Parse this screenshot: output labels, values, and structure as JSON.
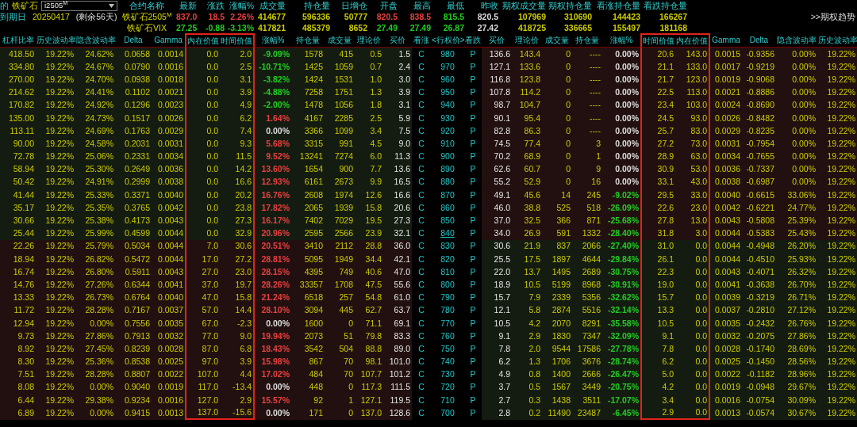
{
  "toolbar": {
    "cut_label": "的",
    "product": "铁矿石",
    "contract_select": "i2505$^{M}$"
  },
  "expiry": {
    "label": "到期日",
    "date": "20250417",
    "remaining": "(剩余56天)"
  },
  "quote_columns": [
    "合约名称",
    "最新",
    "涨跌",
    "涨幅%",
    "成交量",
    "持仓量",
    "日增仓",
    "开盘",
    "最高",
    "最低",
    "昨收",
    "期权成交量",
    "期权持仓量",
    "看涨持仓量",
    "看跌持仓量"
  ],
  "quotes": [
    {
      "name": "铁矿石2505$^{M}$",
      "values": [
        {
          "text": "837.0",
          "color": "#e84040"
        },
        {
          "text": "18.5",
          "color": "#e84040"
        },
        {
          "text": "2.26%",
          "color": "#e84040"
        },
        {
          "text": "414677",
          "color": "#cccc00"
        },
        {
          "text": "596336",
          "color": "#cccc00"
        },
        {
          "text": "50777",
          "color": "#cccc00"
        },
        {
          "text": "820.5",
          "color": "#e84040"
        },
        {
          "text": "838.5",
          "color": "#e84040"
        },
        {
          "text": "815.5",
          "color": "#22cc22"
        },
        {
          "text": "820.5",
          "color": "#dddddd"
        },
        {
          "text": "107969",
          "color": "#cccc00"
        },
        {
          "text": "310690",
          "color": "#cccc00"
        },
        {
          "text": "144423",
          "color": "#cccc00"
        },
        {
          "text": "166267",
          "color": "#cccc00"
        }
      ]
    },
    {
      "name": "铁矿石VIX",
      "values": [
        {
          "text": "27.25",
          "color": "#22cc22"
        },
        {
          "text": "-0.88",
          "color": "#22cc22"
        },
        {
          "text": "-3.13%",
          "color": "#22cc22"
        },
        {
          "text": "417821",
          "color": "#cccc00"
        },
        {
          "text": "485379",
          "color": "#cccc00"
        },
        {
          "text": "8652",
          "color": "#cccc00"
        },
        {
          "text": "27.49",
          "color": "#22cc22"
        },
        {
          "text": "27.49",
          "color": "#22cc22"
        },
        {
          "text": "26.87",
          "color": "#22cc22"
        },
        {
          "text": "27.42",
          "color": "#dddddd"
        },
        {
          "text": "418725",
          "color": "#cccc00"
        },
        {
          "text": "336665",
          "color": "#cccc00"
        },
        {
          "text": "155497",
          "color": "#cccc00"
        },
        {
          "text": "181168",
          "color": "#cccc00"
        }
      ]
    }
  ],
  "trend_link": ">>期权趋势",
  "call_columns": [
    {
      "label": "杠杆比率",
      "highlighted": false
    },
    {
      "label": "历史波动率",
      "highlighted": false
    },
    {
      "label": "隐含波动率",
      "highlighted": false
    },
    {
      "label": "Delta",
      "highlighted": false
    },
    {
      "label": "Gamma",
      "highlighted": false
    },
    {
      "label": "内在价值",
      "highlighted": true
    },
    {
      "label": "时间价值",
      "highlighted": true
    },
    {
      "label": "涨幅%",
      "highlighted": false
    },
    {
      "label": "持仓量",
      "highlighted": false
    },
    {
      "label": "成交量",
      "highlighted": false
    },
    {
      "label": "理论价",
      "highlighted": false
    },
    {
      "label": "买价",
      "highlighted": false
    },
    {
      "label": "看涨",
      "highlighted": false
    }
  ],
  "strike_header": "<行权价>",
  "put_columns": [
    {
      "label": "看跌",
      "highlighted": false
    },
    {
      "label": "买价",
      "highlighted": false
    },
    {
      "label": "理论价",
      "highlighted": false
    },
    {
      "label": "成交量",
      "highlighted": false
    },
    {
      "label": "持仓量",
      "highlighted": false
    },
    {
      "label": "涨幅%",
      "highlighted": false
    },
    {
      "label": "时间价值",
      "highlighted": true
    },
    {
      "label": "内在价值",
      "highlighted": true
    },
    {
      "label": "Gamma",
      "highlighted": false
    },
    {
      "label": "Delta",
      "highlighted": false
    },
    {
      "label": "隐含波动率",
      "highlighted": false
    },
    {
      "label": "历史波动率",
      "highlighted": false
    }
  ],
  "rows": [
    {
      "strike": "980",
      "selected": false,
      "call_itm": false,
      "put_itm": true,
      "call_change": {
        "color": "#22cc22"
      },
      "put_change": {
        "color": "#dddddd"
      },
      "call": [
        "418.50",
        "19.22%",
        "24.62%",
        "0.0658",
        "0.0014",
        "0.0",
        "2.0",
        "-9.09%",
        "1578",
        "415",
        "0.5",
        "1.5",
        "C"
      ],
      "put": [
        "P",
        "136.6",
        "143.4",
        "0",
        "----",
        "0.00%",
        "20.6",
        "143.0",
        "0.0015",
        "-0.9356",
        "0.00%",
        "19.22%"
      ]
    },
    {
      "strike": "970",
      "selected": false,
      "call_itm": false,
      "put_itm": true,
      "call_change": {
        "color": "#22cc22"
      },
      "put_change": {
        "color": "#dddddd"
      },
      "call": [
        "334.80",
        "19.22%",
        "24.67%",
        "0.0790",
        "0.0016",
        "0.0",
        "2.5",
        "-10.71%",
        "1425",
        "1059",
        "0.7",
        "2.4",
        "C"
      ],
      "put": [
        "P",
        "127.1",
        "133.6",
        "0",
        "----",
        "0.00%",
        "21.1",
        "133.0",
        "0.0017",
        "-0.9219",
        "0.00%",
        "19.22%"
      ]
    },
    {
      "strike": "960",
      "selected": false,
      "call_itm": false,
      "put_itm": true,
      "call_change": {
        "color": "#22cc22"
      },
      "put_change": {
        "color": "#dddddd"
      },
      "call": [
        "270.00",
        "19.22%",
        "24.70%",
        "0.0938",
        "0.0018",
        "0.0",
        "3.1",
        "-3.82%",
        "1424",
        "1531",
        "1.0",
        "3.0",
        "C"
      ],
      "put": [
        "P",
        "116.8",
        "123.8",
        "0",
        "----",
        "0.00%",
        "21.7",
        "123.0",
        "0.0019",
        "-0.9068",
        "0.00%",
        "19.22%"
      ]
    },
    {
      "strike": "950",
      "selected": false,
      "call_itm": false,
      "put_itm": true,
      "call_change": {
        "color": "#22cc22"
      },
      "put_change": {
        "color": "#dddddd"
      },
      "call": [
        "214.62",
        "19.22%",
        "24.41%",
        "0.1102",
        "0.0021",
        "0.0",
        "3.9",
        "-4.88%",
        "7258",
        "1751",
        "1.3",
        "3.9",
        "C"
      ],
      "put": [
        "P",
        "107.8",
        "114.2",
        "0",
        "----",
        "0.00%",
        "22.5",
        "113.0",
        "0.0021",
        "-0.8886",
        "0.00%",
        "19.22%"
      ]
    },
    {
      "strike": "940",
      "selected": false,
      "call_itm": false,
      "put_itm": true,
      "call_change": {
        "color": "#22cc22"
      },
      "put_change": {
        "color": "#dddddd"
      },
      "call": [
        "170.82",
        "19.22%",
        "24.92%",
        "0.1296",
        "0.0023",
        "0.0",
        "4.9",
        "-2.00%",
        "1478",
        "1056",
        "1.8",
        "3.1",
        "C"
      ],
      "put": [
        "P",
        "98.7",
        "104.7",
        "0",
        "----",
        "0.00%",
        "23.4",
        "103.0",
        "0.0024",
        "-0.8690",
        "0.00%",
        "19.22%"
      ]
    },
    {
      "strike": "930",
      "selected": false,
      "call_itm": false,
      "put_itm": true,
      "call_change": {
        "color": "#e84040"
      },
      "put_change": {
        "color": "#dddddd"
      },
      "call": [
        "135.00",
        "19.22%",
        "24.73%",
        "0.1517",
        "0.0026",
        "0.0",
        "6.2",
        "1.64%",
        "4167",
        "2285",
        "2.5",
        "5.9",
        "C"
      ],
      "put": [
        "P",
        "90.1",
        "95.4",
        "0",
        "----",
        "0.00%",
        "24.5",
        "93.0",
        "0.0026",
        "-0.8482",
        "0.00%",
        "19.22%"
      ]
    },
    {
      "strike": "920",
      "selected": false,
      "call_itm": false,
      "put_itm": true,
      "call_change": {
        "color": "#dddddd"
      },
      "put_change": {
        "color": "#dddddd"
      },
      "call": [
        "113.11",
        "19.22%",
        "24.69%",
        "0.1763",
        "0.0029",
        "0.0",
        "7.4",
        "0.00%",
        "3366",
        "1099",
        "3.4",
        "7.5",
        "C"
      ],
      "put": [
        "P",
        "82.8",
        "86.3",
        "0",
        "----",
        "0.00%",
        "25.7",
        "83.0",
        "0.0029",
        "-0.8235",
        "0.00%",
        "19.22%"
      ]
    },
    {
      "strike": "910",
      "selected": false,
      "call_itm": false,
      "put_itm": true,
      "call_change": {
        "color": "#e84040"
      },
      "put_change": {
        "color": "#dddddd"
      },
      "call": [
        "90.00",
        "19.22%",
        "24.58%",
        "0.2031",
        "0.0031",
        "0.0",
        "9.3",
        "5.68%",
        "3315",
        "991",
        "4.5",
        "9.0",
        "C"
      ],
      "put": [
        "P",
        "74.5",
        "77.4",
        "0",
        "3",
        "0.00%",
        "27.2",
        "73.0",
        "0.0031",
        "-0.7954",
        "0.00%",
        "19.22%"
      ]
    },
    {
      "strike": "900",
      "selected": false,
      "call_itm": false,
      "put_itm": true,
      "call_change": {
        "color": "#e84040"
      },
      "put_change": {
        "color": "#dddddd"
      },
      "call": [
        "72.78",
        "19.22%",
        "25.06%",
        "0.2331",
        "0.0034",
        "0.0",
        "11.5",
        "9.52%",
        "13241",
        "7274",
        "6.0",
        "11.3",
        "C"
      ],
      "put": [
        "P",
        "70.2",
        "68.9",
        "0",
        "1",
        "0.00%",
        "28.9",
        "63.0",
        "0.0034",
        "-0.7655",
        "0.00%",
        "19.22%"
      ]
    },
    {
      "strike": "890",
      "selected": false,
      "call_itm": false,
      "put_itm": true,
      "call_change": {
        "color": "#e84040"
      },
      "put_change": {
        "color": "#dddddd"
      },
      "call": [
        "58.94",
        "19.22%",
        "25.30%",
        "0.2649",
        "0.0036",
        "0.0",
        "14.2",
        "13.60%",
        "1654",
        "900",
        "7.7",
        "13.6",
        "C"
      ],
      "put": [
        "P",
        "62.6",
        "60.7",
        "0",
        "9",
        "0.00%",
        "30.9",
        "53.0",
        "0.0036",
        "-0.7337",
        "0.00%",
        "19.22%"
      ]
    },
    {
      "strike": "880",
      "selected": false,
      "call_itm": false,
      "put_itm": true,
      "call_change": {
        "color": "#e84040"
      },
      "put_change": {
        "color": "#dddddd"
      },
      "call": [
        "50.42",
        "19.22%",
        "24.91%",
        "0.2999",
        "0.0038",
        "0.0",
        "16.6",
        "12.93%",
        "6161",
        "2673",
        "9.9",
        "16.5",
        "C"
      ],
      "put": [
        "P",
        "55.2",
        "52.9",
        "0",
        "16",
        "0.00%",
        "33.1",
        "43.0",
        "0.0038",
        "-0.6987",
        "0.00%",
        "19.22%"
      ]
    },
    {
      "strike": "870",
      "selected": false,
      "call_itm": false,
      "put_itm": true,
      "call_change": {
        "color": "#e84040"
      },
      "put_change": {
        "color": "#22cc22"
      },
      "call": [
        "41.44",
        "19.22%",
        "25.33%",
        "0.3371",
        "0.0040",
        "0.0",
        "20.2",
        "16.76%",
        "2608",
        "1974",
        "12.6",
        "16.6",
        "C"
      ],
      "put": [
        "P",
        "49.1",
        "45.6",
        "14",
        "245",
        "-9.02%",
        "29.5",
        "33.0",
        "0.0040",
        "-0.6615",
        "33.06%",
        "19.22%"
      ]
    },
    {
      "strike": "860",
      "selected": false,
      "call_itm": false,
      "put_itm": true,
      "call_change": {
        "color": "#e84040"
      },
      "put_change": {
        "color": "#22cc22"
      },
      "call": [
        "35.17",
        "19.22%",
        "25.35%",
        "0.3765",
        "0.0042",
        "0.0",
        "23.8",
        "17.82%",
        "2065",
        "1939",
        "15.8",
        "20.6",
        "C"
      ],
      "put": [
        "P",
        "46.0",
        "38.8",
        "525",
        "518",
        "-26.09%",
        "22.6",
        "23.0",
        "0.0042",
        "-0.6221",
        "24.77%",
        "19.22%"
      ]
    },
    {
      "strike": "850",
      "selected": false,
      "call_itm": false,
      "put_itm": true,
      "call_change": {
        "color": "#e84040"
      },
      "put_change": {
        "color": "#22cc22"
      },
      "call": [
        "30.66",
        "19.22%",
        "25.38%",
        "0.4173",
        "0.0043",
        "0.0",
        "27.3",
        "16.17%",
        "7402",
        "7029",
        "19.5",
        "27.3",
        "C"
      ],
      "put": [
        "P",
        "37.0",
        "32.5",
        "366",
        "871",
        "-25.68%",
        "27.8",
        "13.0",
        "0.0043",
        "-0.5808",
        "25.39%",
        "19.22%"
      ]
    },
    {
      "strike": "840",
      "selected": true,
      "call_itm": false,
      "put_itm": true,
      "call_change": {
        "color": "#e84040"
      },
      "put_change": {
        "color": "#22cc22"
      },
      "call": [
        "25.44",
        "19.22%",
        "25.99%",
        "0.4599",
        "0.0044",
        "0.0",
        "32.9",
        "20.96%",
        "2595",
        "2566",
        "23.9",
        "32.1",
        "C"
      ],
      "put": [
        "P",
        "34.0",
        "26.9",
        "591",
        "1332",
        "-28.40%",
        "31.8",
        "3.0",
        "0.0044",
        "-0.5383",
        "25.43%",
        "19.22%"
      ]
    },
    {
      "strike": "830",
      "selected": false,
      "call_itm": true,
      "put_itm": false,
      "call_change": {
        "color": "#e84040"
      },
      "put_change": {
        "color": "#22cc22"
      },
      "call": [
        "22.26",
        "19.22%",
        "25.79%",
        "0.5034",
        "0.0044",
        "7.0",
        "30.6",
        "20.51%",
        "3410",
        "2112",
        "28.8",
        "36.0",
        "C"
      ],
      "put": [
        "P",
        "30.6",
        "21.9",
        "837",
        "2066",
        "-27.40%",
        "31.0",
        "0.0",
        "0.0044",
        "-0.4948",
        "26.20%",
        "19.22%"
      ]
    },
    {
      "strike": "820",
      "selected": false,
      "call_itm": true,
      "put_itm": false,
      "call_change": {
        "color": "#e84040"
      },
      "put_change": {
        "color": "#22cc22"
      },
      "call": [
        "18.94",
        "19.22%",
        "26.82%",
        "0.5472",
        "0.0044",
        "17.0",
        "27.2",
        "28.81%",
        "5095",
        "1949",
        "34.4",
        "42.1",
        "C"
      ],
      "put": [
        "P",
        "25.5",
        "17.5",
        "1897",
        "4644",
        "-29.84%",
        "26.1",
        "0.0",
        "0.0044",
        "-0.4510",
        "25.93%",
        "19.22%"
      ]
    },
    {
      "strike": "810",
      "selected": false,
      "call_itm": true,
      "put_itm": false,
      "call_change": {
        "color": "#e84040"
      },
      "put_change": {
        "color": "#22cc22"
      },
      "call": [
        "16.74",
        "19.22%",
        "26.80%",
        "0.5911",
        "0.0043",
        "27.0",
        "23.0",
        "28.15%",
        "4395",
        "749",
        "40.6",
        "47.0",
        "C"
      ],
      "put": [
        "P",
        "22.0",
        "13.7",
        "1495",
        "2689",
        "-30.75%",
        "22.3",
        "0.0",
        "0.0043",
        "-0.4071",
        "26.32%",
        "19.22%"
      ]
    },
    {
      "strike": "800",
      "selected": false,
      "call_itm": true,
      "put_itm": false,
      "call_change": {
        "color": "#e84040"
      },
      "put_change": {
        "color": "#22cc22"
      },
      "call": [
        "14.76",
        "19.22%",
        "27.26%",
        "0.6344",
        "0.0041",
        "37.0",
        "19.7",
        "28.26%",
        "33357",
        "1708",
        "47.5",
        "55.6",
        "C"
      ],
      "put": [
        "P",
        "18.9",
        "10.5",
        "5199",
        "8968",
        "-30.91%",
        "19.0",
        "0.0",
        "0.0041",
        "-0.3638",
        "26.70%",
        "19.22%"
      ]
    },
    {
      "strike": "790",
      "selected": false,
      "call_itm": true,
      "put_itm": false,
      "call_change": {
        "color": "#e84040"
      },
      "put_change": {
        "color": "#22cc22"
      },
      "call": [
        "13.33",
        "19.22%",
        "26.73%",
        "0.6764",
        "0.0040",
        "47.0",
        "15.8",
        "21.24%",
        "6518",
        "257",
        "54.8",
        "61.0",
        "C"
      ],
      "put": [
        "P",
        "15.7",
        "7.9",
        "2339",
        "5356",
        "-32.62%",
        "15.7",
        "0.0",
        "0.0039",
        "-0.3219",
        "26.71%",
        "19.22%"
      ]
    },
    {
      "strike": "780",
      "selected": false,
      "call_itm": true,
      "put_itm": false,
      "call_change": {
        "color": "#e84040"
      },
      "put_change": {
        "color": "#22cc22"
      },
      "call": [
        "11.72",
        "19.22%",
        "28.28%",
        "0.7167",
        "0.0037",
        "57.0",
        "14.4",
        "28.10%",
        "3094",
        "445",
        "62.7",
        "63.7",
        "C"
      ],
      "put": [
        "P",
        "12.1",
        "5.8",
        "2874",
        "5516",
        "-32.14%",
        "13.3",
        "0.0",
        "0.0037",
        "-0.2810",
        "27.12%",
        "19.22%"
      ]
    },
    {
      "strike": "770",
      "selected": false,
      "call_itm": true,
      "put_itm": false,
      "call_change": {
        "color": "#dddddd"
      },
      "put_change": {
        "color": "#22cc22"
      },
      "call": [
        "12.94",
        "19.22%",
        "0.00%",
        "0.7556",
        "0.0035",
        "67.0",
        "-2.3",
        "0.00%",
        "1600",
        "0",
        "71.1",
        "69.1",
        "C"
      ],
      "put": [
        "P",
        "10.5",
        "4.2",
        "2070",
        "8291",
        "-35.58%",
        "10.5",
        "0.0",
        "0.0035",
        "-0.2432",
        "26.76%",
        "19.22%"
      ]
    },
    {
      "strike": "760",
      "selected": false,
      "call_itm": true,
      "put_itm": false,
      "call_change": {
        "color": "#e84040"
      },
      "put_change": {
        "color": "#22cc22"
      },
      "call": [
        "9.73",
        "19.22%",
        "27.86%",
        "0.7913",
        "0.0032",
        "77.0",
        "9.0",
        "19.94%",
        "2073",
        "51",
        "79.8",
        "83.3",
        "C"
      ],
      "put": [
        "P",
        "9.1",
        "2.9",
        "1830",
        "7347",
        "-32.09%",
        "9.1",
        "0.0",
        "0.0032",
        "-0.2075",
        "27.86%",
        "19.22%"
      ]
    },
    {
      "strike": "750",
      "selected": false,
      "call_itm": true,
      "put_itm": false,
      "call_change": {
        "color": "#e84040"
      },
      "put_change": {
        "color": "#22cc22"
      },
      "call": [
        "8.92",
        "19.22%",
        "27.45%",
        "0.8239",
        "0.0028",
        "87.0",
        "6.8",
        "18.43%",
        "3542",
        "504",
        "88.8",
        "89.0",
        "C"
      ],
      "put": [
        "P",
        "7.8",
        "2.0",
        "9544",
        "17586",
        "-27.78%",
        "7.8",
        "0.0",
        "0.0028",
        "-0.1740",
        "28.69%",
        "19.22%"
      ]
    },
    {
      "strike": "740",
      "selected": false,
      "call_itm": true,
      "put_itm": false,
      "call_change": {
        "color": "#e84040"
      },
      "put_change": {
        "color": "#22cc22"
      },
      "call": [
        "8.30",
        "19.22%",
        "25.36%",
        "0.8538",
        "0.0025",
        "97.0",
        "3.9",
        "15.98%",
        "867",
        "70",
        "98.1",
        "101.0",
        "C"
      ],
      "put": [
        "P",
        "6.2",
        "1.3",
        "1706",
        "3676",
        "-28.74%",
        "6.2",
        "0.0",
        "0.0025",
        "-0.1450",
        "28.56%",
        "19.22%"
      ]
    },
    {
      "strike": "730",
      "selected": false,
      "call_itm": true,
      "put_itm": false,
      "call_change": {
        "color": "#e84040"
      },
      "put_change": {
        "color": "#22cc22"
      },
      "call": [
        "7.51",
        "19.22%",
        "28.28%",
        "0.8807",
        "0.0022",
        "107.0",
        "4.4",
        "17.02%",
        "484",
        "70",
        "107.7",
        "101.2",
        "C"
      ],
      "put": [
        "P",
        "4.9",
        "0.8",
        "1400",
        "2666",
        "-26.47%",
        "5.0",
        "0.0",
        "0.0022",
        "-0.1182",
        "28.96%",
        "19.22%"
      ]
    },
    {
      "strike": "720",
      "selected": false,
      "call_itm": true,
      "put_itm": false,
      "call_change": {
        "color": "#dddddd"
      },
      "put_change": {
        "color": "#22cc22"
      },
      "call": [
        "8.08",
        "19.22%",
        "0.00%",
        "0.9040",
        "0.0019",
        "117.0",
        "-13.4",
        "0.00%",
        "448",
        "0",
        "117.3",
        "111.5",
        "C"
      ],
      "put": [
        "P",
        "3.7",
        "0.5",
        "1567",
        "3449",
        "-20.75%",
        "4.2",
        "0.0",
        "0.0019",
        "-0.0948",
        "29.67%",
        "19.22%"
      ]
    },
    {
      "strike": "710",
      "selected": false,
      "call_itm": true,
      "put_itm": false,
      "call_change": {
        "color": "#e84040"
      },
      "put_change": {
        "color": "#22cc22"
      },
      "call": [
        "6.44",
        "19.22%",
        "29.38%",
        "0.9234",
        "0.0016",
        "127.0",
        "2.9",
        "15.57%",
        "92",
        "1",
        "127.1",
        "119.5",
        "C"
      ],
      "put": [
        "P",
        "2.7",
        "0.3",
        "1438",
        "3511",
        "-17.07%",
        "3.4",
        "0.0",
        "0.0016",
        "-0.0754",
        "30.09%",
        "19.22%"
      ]
    },
    {
      "strike": "700",
      "selected": false,
      "call_itm": true,
      "put_itm": false,
      "call_change": {
        "color": "#dddddd"
      },
      "put_change": {
        "color": "#22cc22"
      },
      "call": [
        "6.89",
        "19.22%",
        "0.00%",
        "0.9415",
        "0.0013",
        "137.0",
        "-15.6",
        "0.00%",
        "171",
        "0",
        "137.0",
        "128.6",
        "C"
      ],
      "put": [
        "P",
        "2.8",
        "0.2",
        "11490",
        "23487",
        "-6.45%",
        "2.9",
        "0.0",
        "0.0013",
        "-0.0574",
        "30.67%",
        "19.22%"
      ]
    }
  ]
}
